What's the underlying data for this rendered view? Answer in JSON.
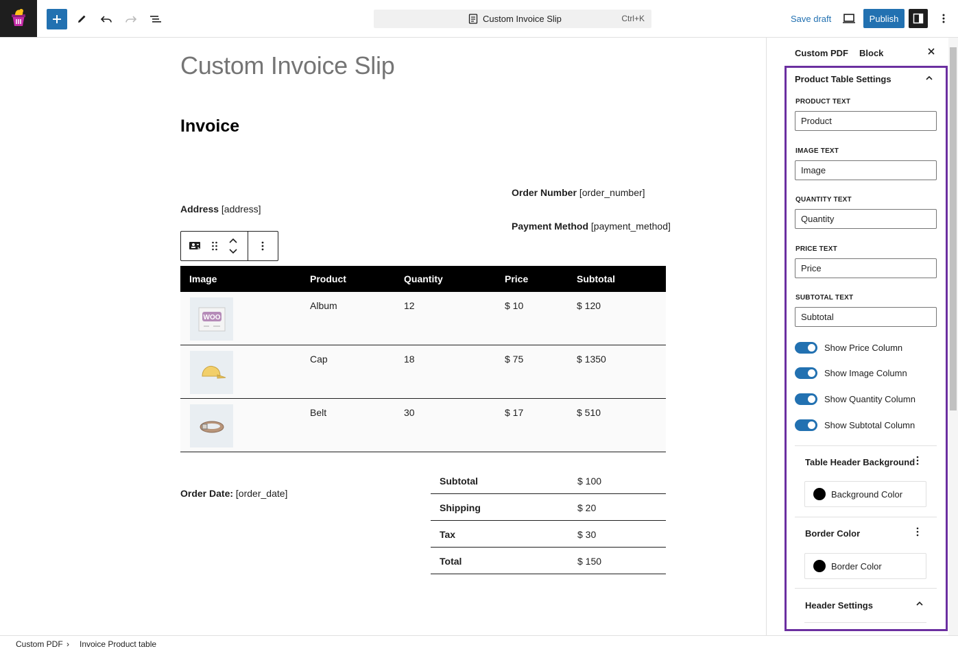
{
  "topbar": {
    "document_title": "Custom Invoice Slip",
    "shortcut": "Ctrl+K",
    "save_draft": "Save draft",
    "publish": "Publish"
  },
  "canvas": {
    "page_title": "Custom Invoice Slip",
    "invoice_heading": "Invoice",
    "order_number_label": "Order Number",
    "order_number_value": "[order_number]",
    "address_label": "Address",
    "address_value": "[address]",
    "payment_method_label": "Payment Method",
    "payment_method_value": "[payment_method]",
    "order_date_label": "Order Date:",
    "order_date_value": "[order_date]"
  },
  "product_table": {
    "headers": [
      "Image",
      "Product",
      "Quantity",
      "Price",
      "Subtotal"
    ],
    "rows": [
      {
        "image_icon": "woo-album-thumbnail",
        "product": "Album",
        "quantity": "12",
        "price": "$ 10",
        "subtotal": "$ 120"
      },
      {
        "image_icon": "cap-thumbnail",
        "product": "Cap",
        "quantity": "18",
        "price": "$ 75",
        "subtotal": "$ 1350"
      },
      {
        "image_icon": "belt-thumbnail",
        "product": "Belt",
        "quantity": "30",
        "price": "$ 17",
        "subtotal": "$ 510"
      }
    ]
  },
  "totals": [
    {
      "label": "Subtotal",
      "value": "$ 100"
    },
    {
      "label": "Shipping",
      "value": "$ 20"
    },
    {
      "label": "Tax",
      "value": "$ 30"
    },
    {
      "label": "Total",
      "value": "$ 150"
    }
  ],
  "sidebar": {
    "tabs": [
      "Custom PDF",
      "Block"
    ],
    "panel_title": "Product Table Settings",
    "fields": [
      {
        "label": "PRODUCT TEXT",
        "value": "Product"
      },
      {
        "label": "IMAGE TEXT",
        "value": "Image"
      },
      {
        "label": "QUANTITY TEXT",
        "value": "Quantity"
      },
      {
        "label": "PRICE TEXT",
        "value": "Price"
      },
      {
        "label": "SUBTOTAL TEXT",
        "value": "Subtotal"
      }
    ],
    "toggles": [
      {
        "label": "Show Price Column",
        "on": true
      },
      {
        "label": "Show Image Column",
        "on": true
      },
      {
        "label": "Show Quantity Column",
        "on": true
      },
      {
        "label": "Show Subtotal Column",
        "on": true
      }
    ],
    "table_header_background": {
      "title": "Table Header Background",
      "button": "Background Color",
      "color": "#000000"
    },
    "border_color": {
      "title": "Border Color",
      "button": "Border Color",
      "color": "#000000"
    },
    "header_settings": "Header Settings"
  },
  "breadcrumb": [
    "Custom PDF",
    "Invoice Product table"
  ],
  "colors": {
    "accent": "#2271b1",
    "highlight": "#6b2fa0"
  }
}
